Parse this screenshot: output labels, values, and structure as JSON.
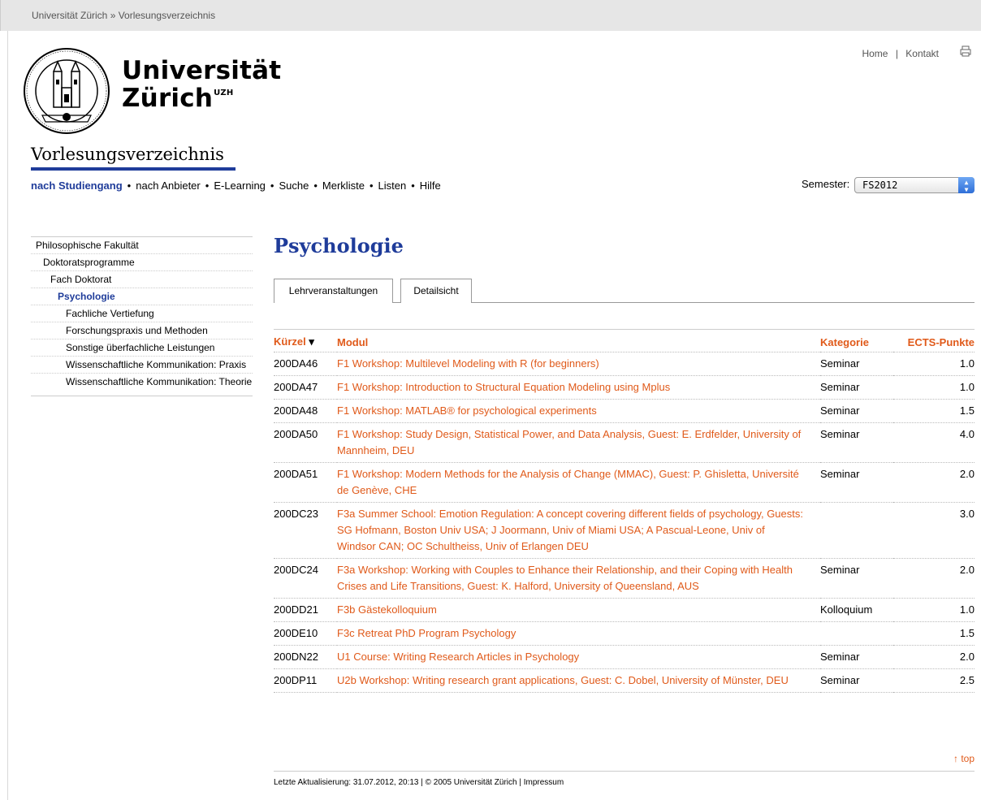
{
  "breadcrumb": "Universität Zürich » Vorlesungsverzeichnis",
  "toplinks": {
    "home": "Home",
    "sep": "|",
    "kontakt": "Kontakt"
  },
  "logo": {
    "line1": "Universität",
    "line2": "Zürich",
    "sup": "UZH"
  },
  "section_title": "Vorlesungsverzeichnis",
  "nav": {
    "items": [
      "nach Studiengang",
      "nach Anbieter",
      "E-Learning",
      "Suche",
      "Merkliste",
      "Listen",
      "Hilfe"
    ],
    "separator": "•"
  },
  "semester": {
    "label": "Semester:",
    "value": "FS2012"
  },
  "sidebar": [
    {
      "label": "Philosophische Fakultät",
      "level": 0
    },
    {
      "label": "Doktoratsprogramme",
      "level": 1
    },
    {
      "label": "Fach Doktorat",
      "level": 2
    },
    {
      "label": "Psychologie",
      "level": 3
    },
    {
      "label": "Fachliche Vertiefung",
      "level": 4
    },
    {
      "label": "Forschungspraxis und Methoden",
      "level": 4
    },
    {
      "label": "Sonstige überfachliche Leistungen",
      "level": 4
    },
    {
      "label": "Wissenschaftliche Kommunikation: Praxis",
      "level": 4
    },
    {
      "label": "Wissenschaftliche Kommunikation: Theorie",
      "level": 4
    }
  ],
  "page_title": "Psychologie",
  "tabs": [
    "Lehrveranstaltungen",
    "Detailsicht"
  ],
  "table": {
    "headers": {
      "code": "Kürzel",
      "sort_arrow": "▾",
      "module": "Modul",
      "category": "Kategorie",
      "ects": "ECTS-Punkte"
    },
    "rows": [
      {
        "code": "200DA46",
        "module": "F1 Workshop: Multilevel Modeling with R (for beginners)",
        "category": "Seminar",
        "ects": "1.0"
      },
      {
        "code": "200DA47",
        "module": "F1 Workshop: Introduction to Structural Equation Modeling using Mplus",
        "category": "Seminar",
        "ects": "1.0"
      },
      {
        "code": "200DA48",
        "module": "F1 Workshop: MATLAB® for psychological experiments",
        "category": "Seminar",
        "ects": "1.5"
      },
      {
        "code": "200DA50",
        "module": "F1 Workshop: Study Design, Statistical Power, and Data Analysis, Guest: E. Erdfelder, University of Mannheim, DEU",
        "category": "Seminar",
        "ects": "4.0"
      },
      {
        "code": "200DA51",
        "module": "F1 Workshop: Modern Methods for the Analysis of Change (MMAC), Guest: P. Ghisletta, Université de Genève, CHE",
        "category": "Seminar",
        "ects": "2.0"
      },
      {
        "code": "200DC23",
        "module": "F3a Summer School: Emotion Regulation: A concept covering different fields of psychology, Guests: SG Hofmann, Boston Univ USA; J Joormann, Univ of Miami USA; A Pascual-Leone, Univ of Windsor CAN; OC Schultheiss, Univ of Erlangen DEU",
        "category": "",
        "ects": "3.0"
      },
      {
        "code": "200DC24",
        "module": "F3a Workshop: Working with Couples to Enhance their Relationship, and their Coping with Health Crises and Life Transitions, Guest: K. Halford, University of Queensland, AUS",
        "category": "Seminar",
        "ects": "2.0"
      },
      {
        "code": "200DD21",
        "module": "F3b Gästekolloquium",
        "category": "Kolloquium",
        "ects": "1.0"
      },
      {
        "code": "200DE10",
        "module": "F3c Retreat PhD Program Psychology",
        "category": "",
        "ects": "1.5"
      },
      {
        "code": "200DN22",
        "module": "U1 Course: Writing Research Articles in Psychology",
        "category": "Seminar",
        "ects": "2.0"
      },
      {
        "code": "200DP11",
        "module": "U2b Workshop: Writing research grant applications, Guest: C. Dobel, University of Münster, DEU",
        "category": "Seminar",
        "ects": "2.5"
      }
    ]
  },
  "top_link": "↑ top",
  "footer": "Letzte Aktualisierung: 31.07.2012, 20:13 | © 2005 Universität Zürich | Impressum",
  "colors": {
    "link_orange": "#e05a1a",
    "uzh_blue": "#1f3c9a"
  }
}
